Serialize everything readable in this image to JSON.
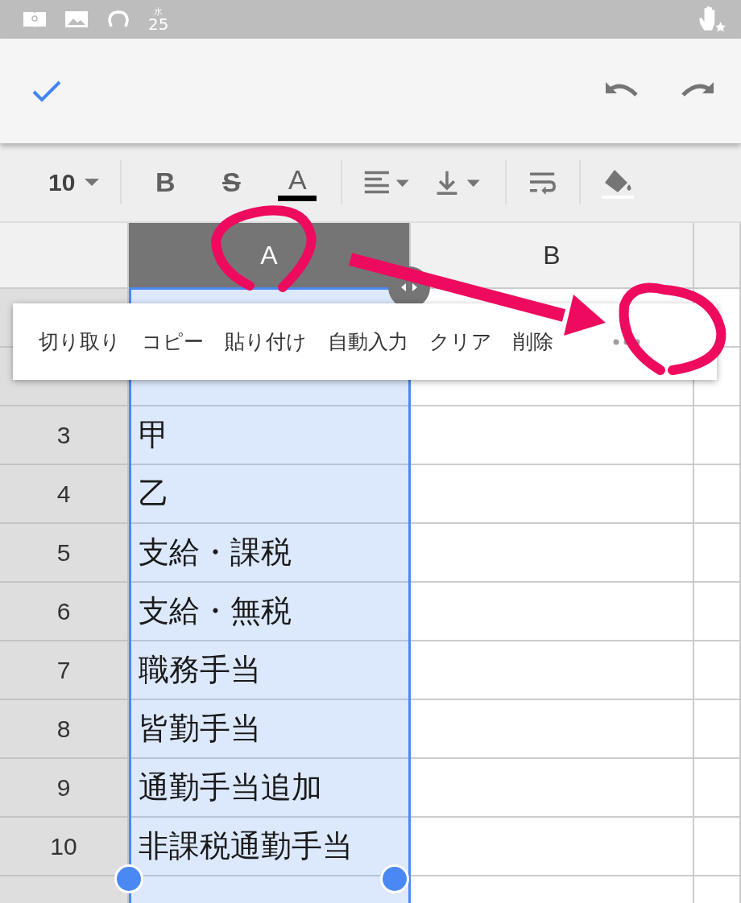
{
  "status_bar": {
    "date_weekday": "水",
    "date_day": "25"
  },
  "toolbar": {
    "font_size": "10",
    "bold": "B",
    "strike": "S",
    "text_color_letter": "A"
  },
  "columns": [
    {
      "label": "A",
      "selected": true
    },
    {
      "label": "B",
      "selected": false
    }
  ],
  "rows": [
    {
      "number": "3",
      "cell": "甲"
    },
    {
      "number": "4",
      "cell": "乙"
    },
    {
      "number": "5",
      "cell": "支給・課税"
    },
    {
      "number": "6",
      "cell": "支給・無税"
    },
    {
      "number": "7",
      "cell": "職務手当"
    },
    {
      "number": "8",
      "cell": "皆勤手当"
    },
    {
      "number": "9",
      "cell": "通勤手当追加"
    },
    {
      "number": "10",
      "cell": "非課税通勤手当"
    }
  ],
  "context_menu": {
    "items": [
      "切り取り",
      "コピー",
      "貼り付け",
      "自動入力",
      "クリア",
      "削除"
    ]
  }
}
